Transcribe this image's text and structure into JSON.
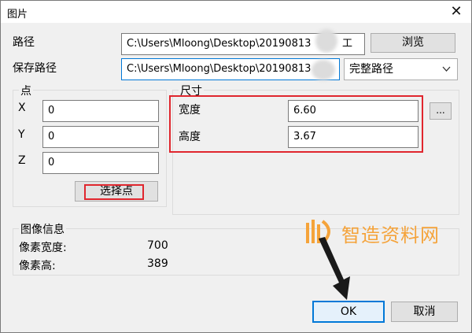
{
  "window": {
    "title": "图片",
    "close_glyph": "✕"
  },
  "path": {
    "label": "路径",
    "value": "C:\\Users\\Mloong\\Desktop\\20190813",
    "value_tail": "工",
    "browse_label": "浏览"
  },
  "save_path": {
    "label": "保存路径",
    "value": "C:\\Users\\Mloong\\Desktop\\20190813",
    "mode_selected": "完整路径"
  },
  "point": {
    "legend": "点",
    "x_label": "X",
    "x_value": "0",
    "y_label": "Y",
    "y_value": "0",
    "z_label": "Z",
    "z_value": "0",
    "select_label": "选择点"
  },
  "size": {
    "legend": "尺寸",
    "width_label": "宽度",
    "width_value": "6.60",
    "height_label": "高度",
    "height_value": "3.67",
    "more_label": "..."
  },
  "image_info": {
    "legend": "图像信息",
    "px_width_label": "像素宽度:",
    "px_width_value": "700",
    "px_height_label": "像素高:",
    "px_height_value": "389"
  },
  "watermark": {
    "text": "智造资料网"
  },
  "buttons": {
    "ok_label": "OK",
    "cancel_label": "取消"
  },
  "colors": {
    "highlight": "#e0262e",
    "watermark": "#f5a33a",
    "ok_focus": "#0078d7"
  }
}
